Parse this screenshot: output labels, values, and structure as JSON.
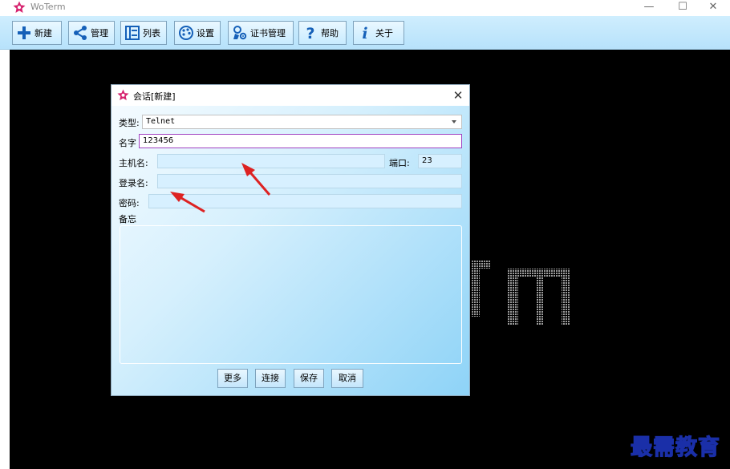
{
  "window": {
    "title": "WoTerm",
    "controls": {
      "minimize": "—",
      "maximize": "☐",
      "close": "✕"
    }
  },
  "toolbar": {
    "items": [
      {
        "label": "新建",
        "icon": "plus-icon"
      },
      {
        "label": "管理",
        "icon": "share-icon"
      },
      {
        "label": "列表",
        "icon": "list-icon"
      },
      {
        "label": "设置",
        "icon": "palette-icon"
      },
      {
        "label": "证书管理",
        "icon": "cert-key-icon"
      },
      {
        "label": "帮助",
        "icon": "help-icon"
      },
      {
        "label": "关于",
        "icon": "info-icon"
      }
    ]
  },
  "dialog": {
    "title": "会话[新建]",
    "close": "✕",
    "type_label": "类型:",
    "type_value": "Telnet",
    "name_label": "名字",
    "name_value": "123456",
    "host_label": "主机名:",
    "host_value": "",
    "port_label": "端口:",
    "port_value": "23",
    "login_label": "登录名:",
    "login_value": "",
    "password_label": "密码:",
    "password_value": "",
    "memo_label": "备忘",
    "buttons": {
      "more": "更多",
      "connect": "连接",
      "save": "保存",
      "cancel": "取消"
    }
  },
  "watermark": "最需教育",
  "colors": {
    "terminal_bg": "#000000",
    "toolbar_bg": "#c4e8fc",
    "dialog_gradient_end": "#8ed3f7",
    "logo": "#d6226e",
    "annotation_arrow": "#dd2222",
    "watermark_stroke": "#1a2fa8"
  }
}
